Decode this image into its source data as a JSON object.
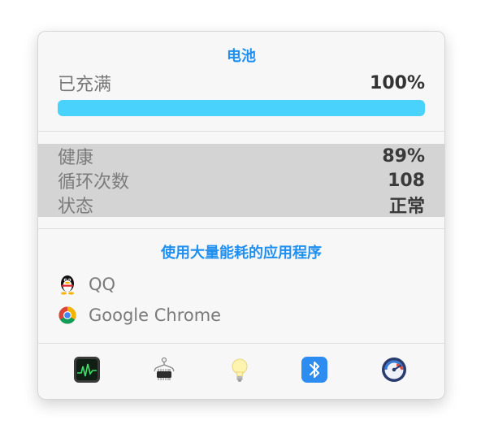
{
  "battery": {
    "title": "电池",
    "charge_label": "已充满",
    "charge_value": "100%",
    "charge_level": 1.0,
    "bar_color": "#49d2fb"
  },
  "stats": [
    {
      "label": "健康",
      "value": "89%"
    },
    {
      "label": "循环次数",
      "value": "108"
    },
    {
      "label": "状态",
      "value": "正常"
    }
  ],
  "apps": {
    "title": "使用大量能耗的应用程序",
    "items": [
      {
        "name": "QQ",
        "icon": "qq-penguin-icon"
      },
      {
        "name": "Google Chrome",
        "icon": "google-chrome-icon"
      }
    ]
  },
  "toolbar": [
    {
      "icon": "activity-monitor-icon"
    },
    {
      "icon": "system-information-icon"
    },
    {
      "icon": "lightbulb-icon"
    },
    {
      "icon": "bluetooth-icon"
    },
    {
      "icon": "istat-menus-icon"
    }
  ],
  "colors": {
    "accent": "#1f8ff0",
    "stats_band": "#d4d4d4"
  }
}
